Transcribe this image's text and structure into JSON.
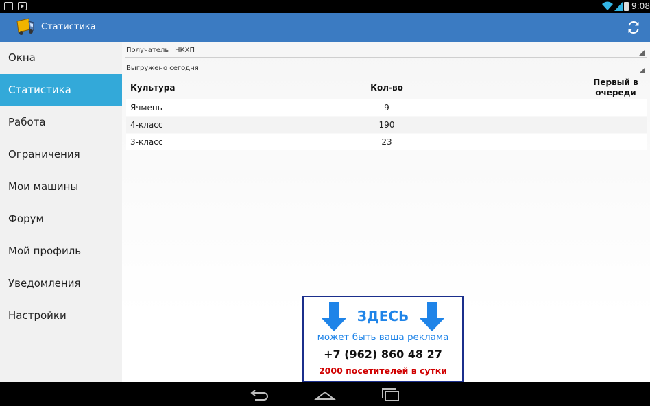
{
  "status_bar": {
    "time": "9:08",
    "notification_icons": [
      "clipboard-check-icon",
      "play-store-icon"
    ],
    "system_icons": [
      "wifi-icon",
      "signal-icon",
      "battery-icon"
    ]
  },
  "action_bar": {
    "title": "Статистика",
    "app_icon": "truck-icon",
    "refresh_icon": "refresh-icon",
    "color": "#3b7bc2"
  },
  "drawer": {
    "items": [
      {
        "label": "Окна",
        "active": false
      },
      {
        "label": "Статистика",
        "active": true
      },
      {
        "label": "Работа",
        "active": false
      },
      {
        "label": "Ограничения",
        "active": false
      },
      {
        "label": "Мои машины",
        "active": false
      },
      {
        "label": "Форум",
        "active": false
      },
      {
        "label": "Мой профиль",
        "active": false
      },
      {
        "label": "Уведомления",
        "active": false
      },
      {
        "label": "Настройки",
        "active": false
      }
    ],
    "active_color": "#33a9d9"
  },
  "filters": {
    "receiver_label": "Получатель",
    "receiver_value": "НКХП",
    "date_value": "Выгружено сегодня"
  },
  "table": {
    "headers": {
      "culture": "Культура",
      "count": "Кол-во",
      "first_line1": "Первый в",
      "first_line2": "очереди"
    },
    "rows": [
      {
        "culture": "Ячмень",
        "count": "9"
      },
      {
        "culture": "4-класс",
        "count": "190"
      },
      {
        "culture": "3-класс",
        "count": "23"
      }
    ]
  },
  "ad": {
    "headline": "ЗДЕСЬ",
    "subline": "может быть  ваша реклама",
    "phone": "+7 (962) 860 48 27",
    "visitors": "2000 посетителей в сутки",
    "accent_color": "#1f84e8",
    "warn_color": "#d00000"
  },
  "nav_bar": {
    "icons": [
      "back-icon",
      "home-icon",
      "recents-icon"
    ]
  }
}
